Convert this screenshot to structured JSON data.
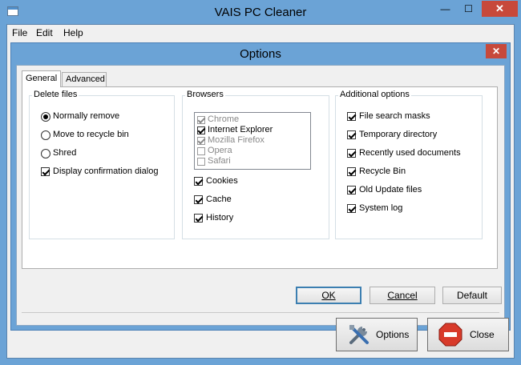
{
  "window": {
    "title": "VAIS PC Cleaner",
    "minimize": "—",
    "maximize": "☐",
    "close": "✕"
  },
  "menu": {
    "file": "File",
    "edit": "Edit",
    "help": "Help"
  },
  "dialog": {
    "title": "Options",
    "close": "✕",
    "tabs": [
      "General",
      "Advanced"
    ],
    "delete_files": {
      "title": "Delete files",
      "options": [
        {
          "label": "Normally remove",
          "selected": true
        },
        {
          "label": "Move to recycle bin",
          "selected": false
        },
        {
          "label": "Shred",
          "selected": false
        }
      ],
      "confirm": {
        "label": "Display confirmation dialog",
        "checked": true
      }
    },
    "browsers": {
      "title": "Browsers",
      "list": [
        {
          "label": "Chrome",
          "checked": true,
          "enabled": false
        },
        {
          "label": "Internet Explorer",
          "checked": true,
          "enabled": true
        },
        {
          "label": "Mozilla Firefox",
          "checked": true,
          "enabled": false
        },
        {
          "label": "Opera",
          "checked": false,
          "enabled": false
        },
        {
          "label": "Safari",
          "checked": false,
          "enabled": false
        }
      ],
      "checks": [
        {
          "label": "Cookies",
          "checked": true
        },
        {
          "label": "Cache",
          "checked": true
        },
        {
          "label": "History",
          "checked": true
        }
      ]
    },
    "additional": {
      "title": "Additional options",
      "checks": [
        {
          "label": "File search masks",
          "checked": true
        },
        {
          "label": "Temporary directory",
          "checked": true
        },
        {
          "label": "Recently used documents",
          "checked": true
        },
        {
          "label": "Recycle Bin",
          "checked": true
        },
        {
          "label": "Old Update files",
          "checked": true
        },
        {
          "label": "System log",
          "checked": true
        }
      ]
    },
    "buttons": {
      "ok": "OK",
      "cancel": "Cancel",
      "default": "Default"
    }
  },
  "main_buttons": {
    "options": "Options",
    "close": "Close"
  }
}
